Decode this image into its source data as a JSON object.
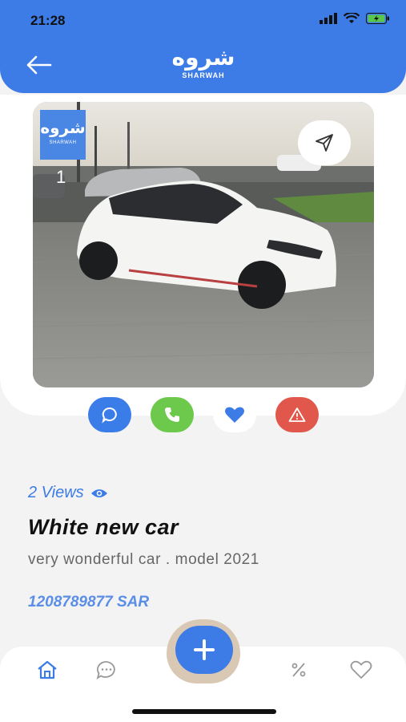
{
  "status": {
    "time": "21:28"
  },
  "header": {
    "logo_glyph": "شروه",
    "logo_word": "SHARWAH"
  },
  "listing": {
    "watermark_glyph": "شروه",
    "watermark_word": "SHARWAH",
    "image_counter": "1",
    "views_text": "2 Views",
    "title": "White new car",
    "description": "very wonderful car . model 2021",
    "price": "1208789877 SAR"
  },
  "colors": {
    "brand": "#3d7be6",
    "chat": "#3b7de8",
    "call": "#6dc94b",
    "favorite": "#3d7be6",
    "report": "#e1574b"
  },
  "icons": {
    "back": "arrow-left-icon",
    "share": "send-icon",
    "chat": "chat-bubble-icon",
    "call": "phone-icon",
    "favorite": "heart-icon",
    "report": "warning-icon",
    "nav_home": "home-icon",
    "nav_chat": "chat-icon",
    "nav_add": "plus-icon",
    "nav_offers": "percent-icon",
    "nav_favorites": "heart-outline-icon"
  }
}
